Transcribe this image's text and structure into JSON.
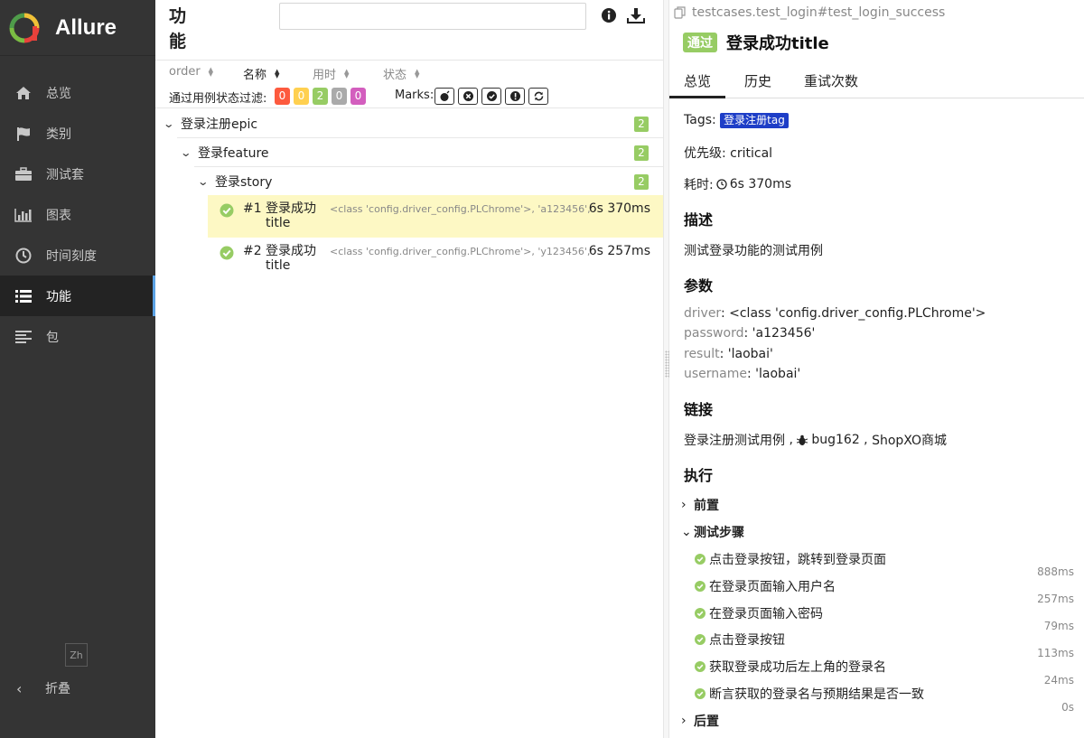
{
  "brand": {
    "name": "Allure"
  },
  "sidebar": {
    "items": [
      {
        "label": "总览",
        "icon": "home-icon"
      },
      {
        "label": "类别",
        "icon": "flag-icon"
      },
      {
        "label": "测试套",
        "icon": "briefcase-icon"
      },
      {
        "label": "图表",
        "icon": "bar-chart-icon"
      },
      {
        "label": "时间刻度",
        "icon": "clock-icon"
      },
      {
        "label": "功能",
        "icon": "list-icon",
        "active": true
      },
      {
        "label": "包",
        "icon": "align-left-icon"
      }
    ],
    "lang": "Zh",
    "collapse_label": "折叠"
  },
  "middle": {
    "title": "功能",
    "search": {
      "value": "",
      "placeholder": ""
    },
    "sort": [
      "order",
      "名称",
      "用时",
      "状态"
    ],
    "filter_label": "通过用例状态过滤:",
    "status_filters": [
      {
        "value": "0",
        "color": "#fd5a3e"
      },
      {
        "value": "0",
        "color": "#ffd050"
      },
      {
        "value": "2",
        "color": "#97cc64"
      },
      {
        "value": "0",
        "color": "#aaaaaa"
      },
      {
        "value": "0",
        "color": "#d35ebe"
      }
    ],
    "marks_label": "Marks:",
    "mark_icons": [
      "bomb-icon",
      "x-circle-icon",
      "check-circle-icon",
      "info-icon",
      "retry-icon"
    ],
    "tree": {
      "epic": {
        "label": "登录注册epic",
        "count": "2"
      },
      "feature": {
        "label": "登录feature",
        "count": "2"
      },
      "story": {
        "label": "登录story",
        "count": "2"
      },
      "cases": [
        {
          "num": "#1",
          "name": "登录成功title",
          "params": "<class 'config.driver_config.PLChrome'>, 'a123456', 'l...",
          "duration": "6s 370ms",
          "selected": true
        },
        {
          "num": "#2",
          "name": "登录成功title",
          "params": "<class 'config.driver_config.PLChrome'>, 'y123456', 'p...",
          "duration": "6s 257ms",
          "selected": false
        }
      ]
    }
  },
  "detail": {
    "path": "testcases.test_login#test_login_success",
    "status": "通过",
    "title": "登录成功title",
    "tabs": [
      "总览",
      "历史",
      "重试次数"
    ],
    "tags_label": "Tags:",
    "tag": "登录注册tag",
    "severity": "优先级: critical",
    "duration_label": "耗时:",
    "duration": "6s 370ms",
    "description_title": "描述",
    "description": "测试登录功能的测试用例",
    "params_title": "参数",
    "params": [
      {
        "key": "driver",
        "value": "<class 'config.driver_config.PLChrome'>"
      },
      {
        "key": "password",
        "value": "'a123456'"
      },
      {
        "key": "result",
        "value": "'laobai'"
      },
      {
        "key": "username",
        "value": "'laobai'"
      }
    ],
    "links_title": "链接",
    "links": {
      "first": "登录注册测试用例",
      "bug": "bug162",
      "shop": "ShopXO商城"
    },
    "execution_title": "执行",
    "setup": "前置",
    "steps_title": "测试步骤",
    "steps": [
      {
        "label": "点击登录按钮，跳转到登录页面",
        "time": "888ms"
      },
      {
        "label": "在登录页面输入用户名",
        "time": "257ms"
      },
      {
        "label": "在登录页面输入密码",
        "time": "79ms"
      },
      {
        "label": "点击登录按钮",
        "time": "113ms"
      },
      {
        "label": "获取登录成功后左上角的登录名",
        "time": "24ms"
      },
      {
        "label": "断言获取的登录名与预期结果是否一致",
        "time": "0s"
      }
    ],
    "teardown": "后置"
  }
}
